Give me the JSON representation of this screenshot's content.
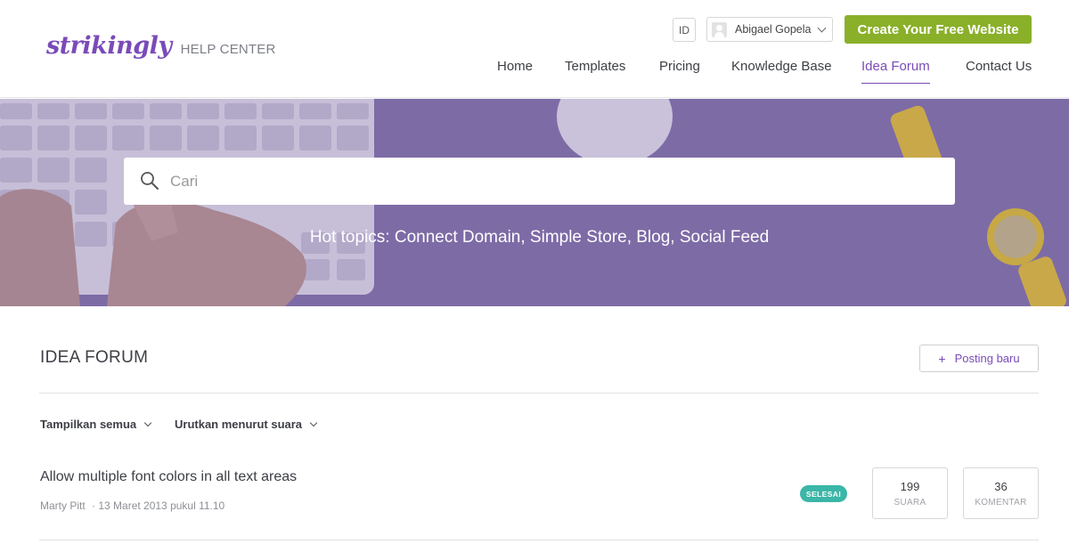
{
  "header": {
    "logo_word": "strikingly",
    "logo_sub": "HELP CENTER",
    "lang": "ID",
    "user_name": "Abigael Gopela",
    "cta": "Create Your Free Website",
    "nav": [
      "Home",
      "Templates",
      "Pricing",
      "Knowledge Base",
      "Idea Forum",
      "Contact Us"
    ],
    "active_nav": "Idea Forum"
  },
  "hero": {
    "search_placeholder": "Cari",
    "hot_topics": "Hot topics: Connect Domain, Simple Store, Blog, Social Feed"
  },
  "forum": {
    "title": "IDEA FORUM",
    "new_post_label": "Posting baru",
    "filters": [
      "Tampilkan semua",
      "Urutkan menurut suara"
    ],
    "posts": [
      {
        "title": "Allow multiple font colors in all text areas",
        "author": "Marty Pitt",
        "date": "· 13 Maret 2013 pukul 11.10",
        "status": "SELESAI",
        "votes": "199",
        "votes_label": "SUARA",
        "comments": "36",
        "comments_label": "KOMENTAR"
      }
    ]
  },
  "colors": {
    "brand_purple": "#7a4bb8",
    "cta_green": "#8ab02a",
    "status_teal": "#3bb6a7",
    "hero_overlay": "#7d6ba6"
  }
}
